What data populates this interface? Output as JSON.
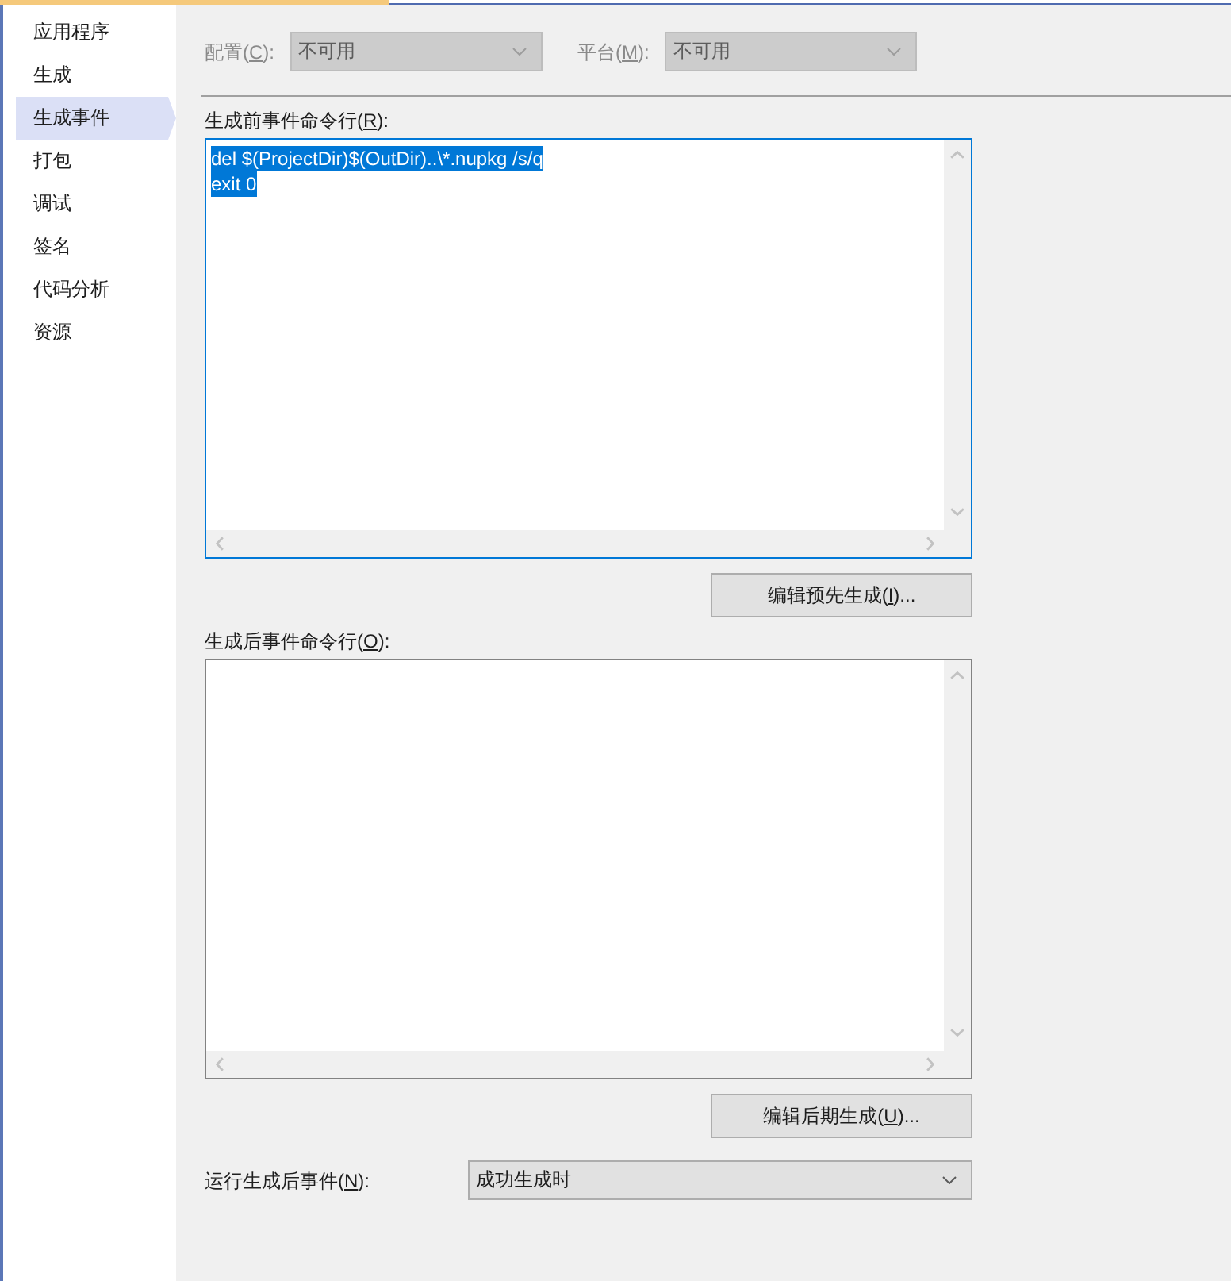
{
  "sidebar": {
    "items": [
      {
        "label": "应用程序",
        "selected": false
      },
      {
        "label": "生成",
        "selected": false
      },
      {
        "label": "生成事件",
        "selected": true
      },
      {
        "label": "打包",
        "selected": false
      },
      {
        "label": "调试",
        "selected": false
      },
      {
        "label": "签名",
        "selected": false
      },
      {
        "label": "代码分析",
        "selected": false
      },
      {
        "label": "资源",
        "selected": false
      }
    ]
  },
  "toolbar": [
    {
      "label": {
        "before": "配置(",
        "key": "C",
        "after": "):"
      },
      "value": "不可用",
      "disabled": true
    },
    {
      "label": {
        "before": "平台(",
        "key": "M",
        "after": "):"
      },
      "value": "不可用",
      "disabled": true
    }
  ],
  "command_sections": [
    {
      "label": {
        "before": "生成前事件命令行(",
        "key": "R",
        "after": "):"
      },
      "lines": [
        "del $(ProjectDir)$(OutDir)..\\*.nupkg /s/q",
        "exit 0"
      ],
      "text_selected": true,
      "focused": true,
      "button": {
        "before": "编辑预先生成(",
        "key": "I",
        "after": ")..."
      }
    },
    {
      "label": {
        "before": "生成后事件命令行(",
        "key": "O",
        "after": "):"
      },
      "focused": false,
      "button": {
        "before": "编辑后期生成(",
        "key": "U",
        "after": ")..."
      }
    }
  ],
  "run_post_build": {
    "label": {
      "before": "运行生成后事件(",
      "key": "N",
      "after": "):"
    },
    "value": "成功生成时",
    "disabled": false
  }
}
